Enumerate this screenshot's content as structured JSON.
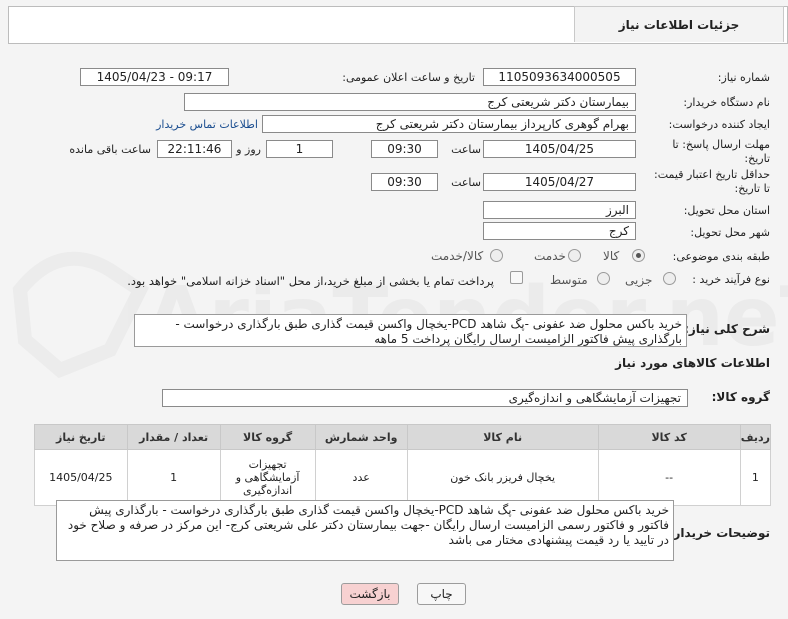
{
  "header": {
    "title": "جزئیات اطلاعات نیاز"
  },
  "fields": {
    "need_number_label": "شماره نیاز:",
    "need_number": "1105093634000505",
    "announce_label": "تاریخ و ساعت اعلان عمومی:",
    "announce_value": "1405/04/23 - 09:17",
    "buyer_org_label": "نام دستگاه خریدار:",
    "buyer_org": "بیمارستان دکتر شریعتی کرج",
    "creator_label": "ایجاد کننده درخواست:",
    "creator": "بهرام گوهری کارپرداز بیمارستان دکتر شریعتی کرج",
    "contact_link": "اطلاعات تماس خریدار",
    "reply_deadline_label_1": "مهلت ارسال پاسخ: تا",
    "reply_deadline_label_2": "تاریخ:",
    "reply_date": "1405/04/25",
    "time_label": "ساعت",
    "reply_time": "09:30",
    "days_value": "1",
    "days_label": "روز و",
    "remaining_time": "22:11:46",
    "remaining_label": "ساعت باقی مانده",
    "price_validity_label_1": "حداقل تاریخ اعتبار قیمت:",
    "price_validity_label_2": "تا تاریخ:",
    "validity_date": "1405/04/27",
    "validity_time": "09:30",
    "province_label": "استان محل تحویل:",
    "province": "البرز",
    "city_label": "شهر محل تحویل:",
    "city": "کرج",
    "category_label": "طبقه بندی موضوعی:",
    "category_options": [
      "کالا",
      "خدمت",
      "کالا/خدمت"
    ],
    "process_label": "نوع فرآیند خرید :",
    "process_options": [
      "جزیی",
      "متوسط"
    ],
    "payment_note": "پرداخت تمام یا بخشی از مبلغ خرید،از محل \"اسناد خزانه اسلامی\" خواهد بود."
  },
  "summary": {
    "label": "شرح کلی نیاز:",
    "text": "خرید باکس محلول ضد عفونی -پگ شاهد PCD-یخچال واکسن قیمت گذاری طبق بارگذاری درخواست  - بارگذاری  پیش فاکتور  الزامیست ارسال رایگان پرداخت 5 ماهه"
  },
  "goods_info_title": "اطلاعات کالاهای مورد نیاز",
  "goods_group": {
    "label": "گروه کالا:",
    "value": "تجهیزات آزمایشگاهی و اندازه‌گیری"
  },
  "table": {
    "headers": [
      "ردیف",
      "کد کالا",
      "نام کالا",
      "واحد شمارش",
      "گروه کالا",
      "تعداد / مقدار",
      "تاریخ نیاز"
    ],
    "rows": [
      {
        "row": "1",
        "code": "--",
        "name": "یخچال فریزر بانک خون",
        "unit": "عدد",
        "group": "تجهیزات آزمایشگاهی و اندازه‌گیری",
        "qty": "1",
        "date": "1405/04/25"
      }
    ]
  },
  "buyer_notes": {
    "label": "توضیحات خریدار:",
    "text": "خرید باکس محلول ضد عفونی -پگ شاهد PCD-یخچال واکسن قیمت گذاری   طبق بارگذاری درخواست  - بارگذاری  پیش فاکتور و فاکتور رسمی الزامیست ارسال رایگان -جهت بیمارستان دکتر علی شریعتی کرج- این مرکز در صرفه و صلاح خود در تایید یا رد قیمت پیشنهادی مختار می باشد"
  },
  "buttons": {
    "print": "چاپ",
    "back": "بازگشت"
  },
  "watermark": {
    "text": "AriaTender.neT"
  },
  "colors": {
    "link": "#1a4d8f",
    "back_button": "#f7d1d1"
  }
}
